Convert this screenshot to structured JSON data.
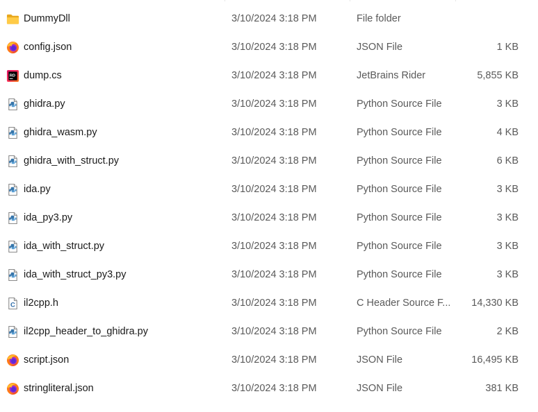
{
  "files": [
    {
      "name": "DummyDll",
      "date": "3/10/2024 3:18 PM",
      "type": "File folder",
      "size": "",
      "icon": "folder-icon"
    },
    {
      "name": "config.json",
      "date": "3/10/2024 3:18 PM",
      "type": "JSON File",
      "size": "1 KB",
      "icon": "firefox-icon"
    },
    {
      "name": "dump.cs",
      "date": "3/10/2024 3:18 PM",
      "type": "JetBrains Rider",
      "size": "5,855 KB",
      "icon": "rider-icon"
    },
    {
      "name": "ghidra.py",
      "date": "3/10/2024 3:18 PM",
      "type": "Python Source File",
      "size": "3 KB",
      "icon": "python-file-icon"
    },
    {
      "name": "ghidra_wasm.py",
      "date": "3/10/2024 3:18 PM",
      "type": "Python Source File",
      "size": "4 KB",
      "icon": "python-file-icon"
    },
    {
      "name": "ghidra_with_struct.py",
      "date": "3/10/2024 3:18 PM",
      "type": "Python Source File",
      "size": "6 KB",
      "icon": "python-file-icon"
    },
    {
      "name": "ida.py",
      "date": "3/10/2024 3:18 PM",
      "type": "Python Source File",
      "size": "3 KB",
      "icon": "python-file-icon"
    },
    {
      "name": "ida_py3.py",
      "date": "3/10/2024 3:18 PM",
      "type": "Python Source File",
      "size": "3 KB",
      "icon": "python-file-icon"
    },
    {
      "name": "ida_with_struct.py",
      "date": "3/10/2024 3:18 PM",
      "type": "Python Source File",
      "size": "3 KB",
      "icon": "python-file-icon"
    },
    {
      "name": "ida_with_struct_py3.py",
      "date": "3/10/2024 3:18 PM",
      "type": "Python Source File",
      "size": "3 KB",
      "icon": "python-file-icon"
    },
    {
      "name": "il2cpp.h",
      "date": "3/10/2024 3:18 PM",
      "type": "C Header Source F...",
      "size": "14,330 KB",
      "icon": "c-header-file-icon"
    },
    {
      "name": "il2cpp_header_to_ghidra.py",
      "date": "3/10/2024 3:18 PM",
      "type": "Python Source File",
      "size": "2 KB",
      "icon": "python-file-icon"
    },
    {
      "name": "script.json",
      "date": "3/10/2024 3:18 PM",
      "type": "JSON File",
      "size": "16,495 KB",
      "icon": "firefox-icon"
    },
    {
      "name": "stringliteral.json",
      "date": "3/10/2024 3:18 PM",
      "type": "JSON File",
      "size": "381 KB",
      "icon": "firefox-icon"
    }
  ]
}
